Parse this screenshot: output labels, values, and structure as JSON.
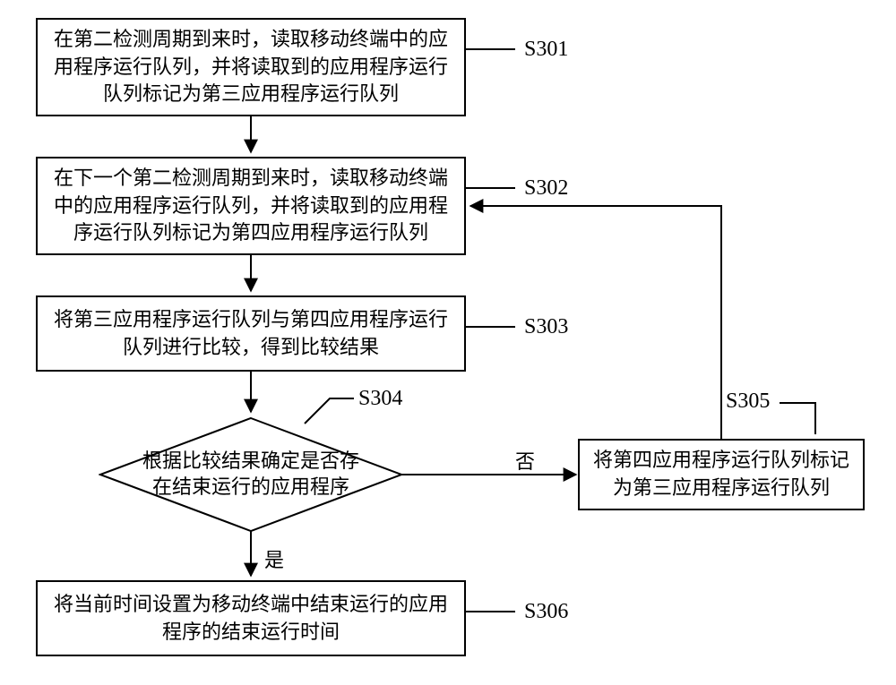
{
  "chart_data": {
    "type": "flowchart",
    "title": "",
    "nodes": [
      {
        "id": "S301",
        "type": "process",
        "text": "在第二检测周期到来时，读取移动终端中的应用程序运行队列，并将读取到的应用程序运行队列标记为第三应用程序运行队列"
      },
      {
        "id": "S302",
        "type": "process",
        "text": "在下一个第二检测周期到来时，读取移动终端中的应用程序运行队列，并将读取到的应用程序运行队列标记为第四应用程序运行队列"
      },
      {
        "id": "S303",
        "type": "process",
        "text": "将第三应用程序运行队列与第四应用程序运行队列进行比较，得到比较结果"
      },
      {
        "id": "S304",
        "type": "decision",
        "text": "根据比较结果确定是否存在结束运行的应用程序"
      },
      {
        "id": "S305",
        "type": "process",
        "text": "将第四应用程序运行队列标记为第三应用程序运行队列"
      },
      {
        "id": "S306",
        "type": "process",
        "text": "将当前时间设置为移动终端中结束运行的应用程序的结束运行时间"
      }
    ],
    "edges": [
      {
        "from": "S301",
        "to": "S302",
        "label": ""
      },
      {
        "from": "S302",
        "to": "S303",
        "label": ""
      },
      {
        "from": "S303",
        "to": "S304",
        "label": ""
      },
      {
        "from": "S304",
        "to": "S306",
        "label": "是"
      },
      {
        "from": "S304",
        "to": "S305",
        "label": "否"
      },
      {
        "from": "S305",
        "to": "S302",
        "label": ""
      }
    ]
  },
  "nodes": {
    "s301": {
      "text": "在第二检测周期到来时，读取移动终端中的应用程序运行队列，并将读取到的应用程序运行队列标记为第三应用程序运行队列",
      "label": "S301"
    },
    "s302": {
      "text": "在下一个第二检测周期到来时，读取移动终端中的应用程序运行队列，并将读取到的应用程序运行队列标记为第四应用程序运行队列",
      "label": "S302"
    },
    "s303": {
      "text": "将第三应用程序运行队列与第四应用程序运行队列进行比较，得到比较结果",
      "label": "S303"
    },
    "s304": {
      "text": "根据比较结果确定是否存在结束运行的应用程序",
      "label": "S304"
    },
    "s305": {
      "text": "将第四应用程序运行队列标记为第三应用程序运行队列",
      "label": "S305"
    },
    "s306": {
      "text": "将当前时间设置为移动终端中结束运行的应用程序的结束运行时间",
      "label": "S306"
    }
  },
  "edgeLabels": {
    "yes": "是",
    "no": "否"
  }
}
